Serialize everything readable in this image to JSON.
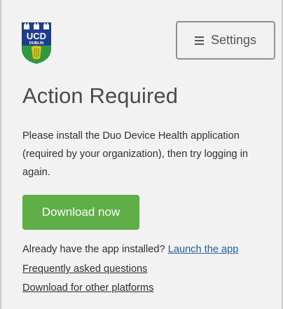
{
  "logo": {
    "name": "UCD",
    "sub": "DUBLIN",
    "colors": {
      "blue": "#1f3d8f",
      "green": "#2e9a3b",
      "yellow": "#f2c21b"
    }
  },
  "header": {
    "settings_label": "Settings",
    "settings_icon": "hamburger-menu-icon"
  },
  "main": {
    "title": "Action Required",
    "message": "Please install the Duo Device Health application (required by your organization), then try logging in again.",
    "download_label": "Download now",
    "already_text": "Already have the app installed?",
    "launch_link": "Launch the app",
    "faq_link": "Frequently asked questions",
    "other_platforms_link": "Download for other platforms"
  },
  "colors": {
    "accent_green": "#5fae47",
    "link_blue": "#1f5fa8"
  }
}
